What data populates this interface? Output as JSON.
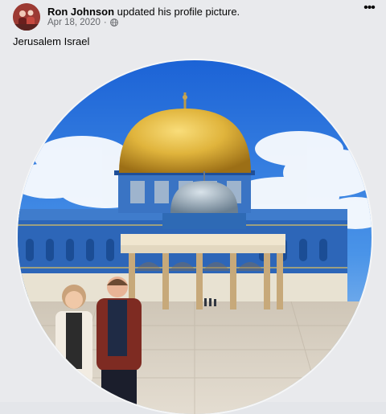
{
  "post": {
    "author": "Ron Johnson",
    "action": "updated his profile picture.",
    "date": "Apr 18, 2020",
    "separator": "·",
    "privacy_icon": "globe-icon",
    "more_label": "•••",
    "caption": "Jerusalem Israel"
  },
  "colors": {
    "sky": "#2f7fe0",
    "dome": "#e0b43c",
    "tile_blue": "#2d66b8",
    "plaza": "#d7cfc2"
  }
}
